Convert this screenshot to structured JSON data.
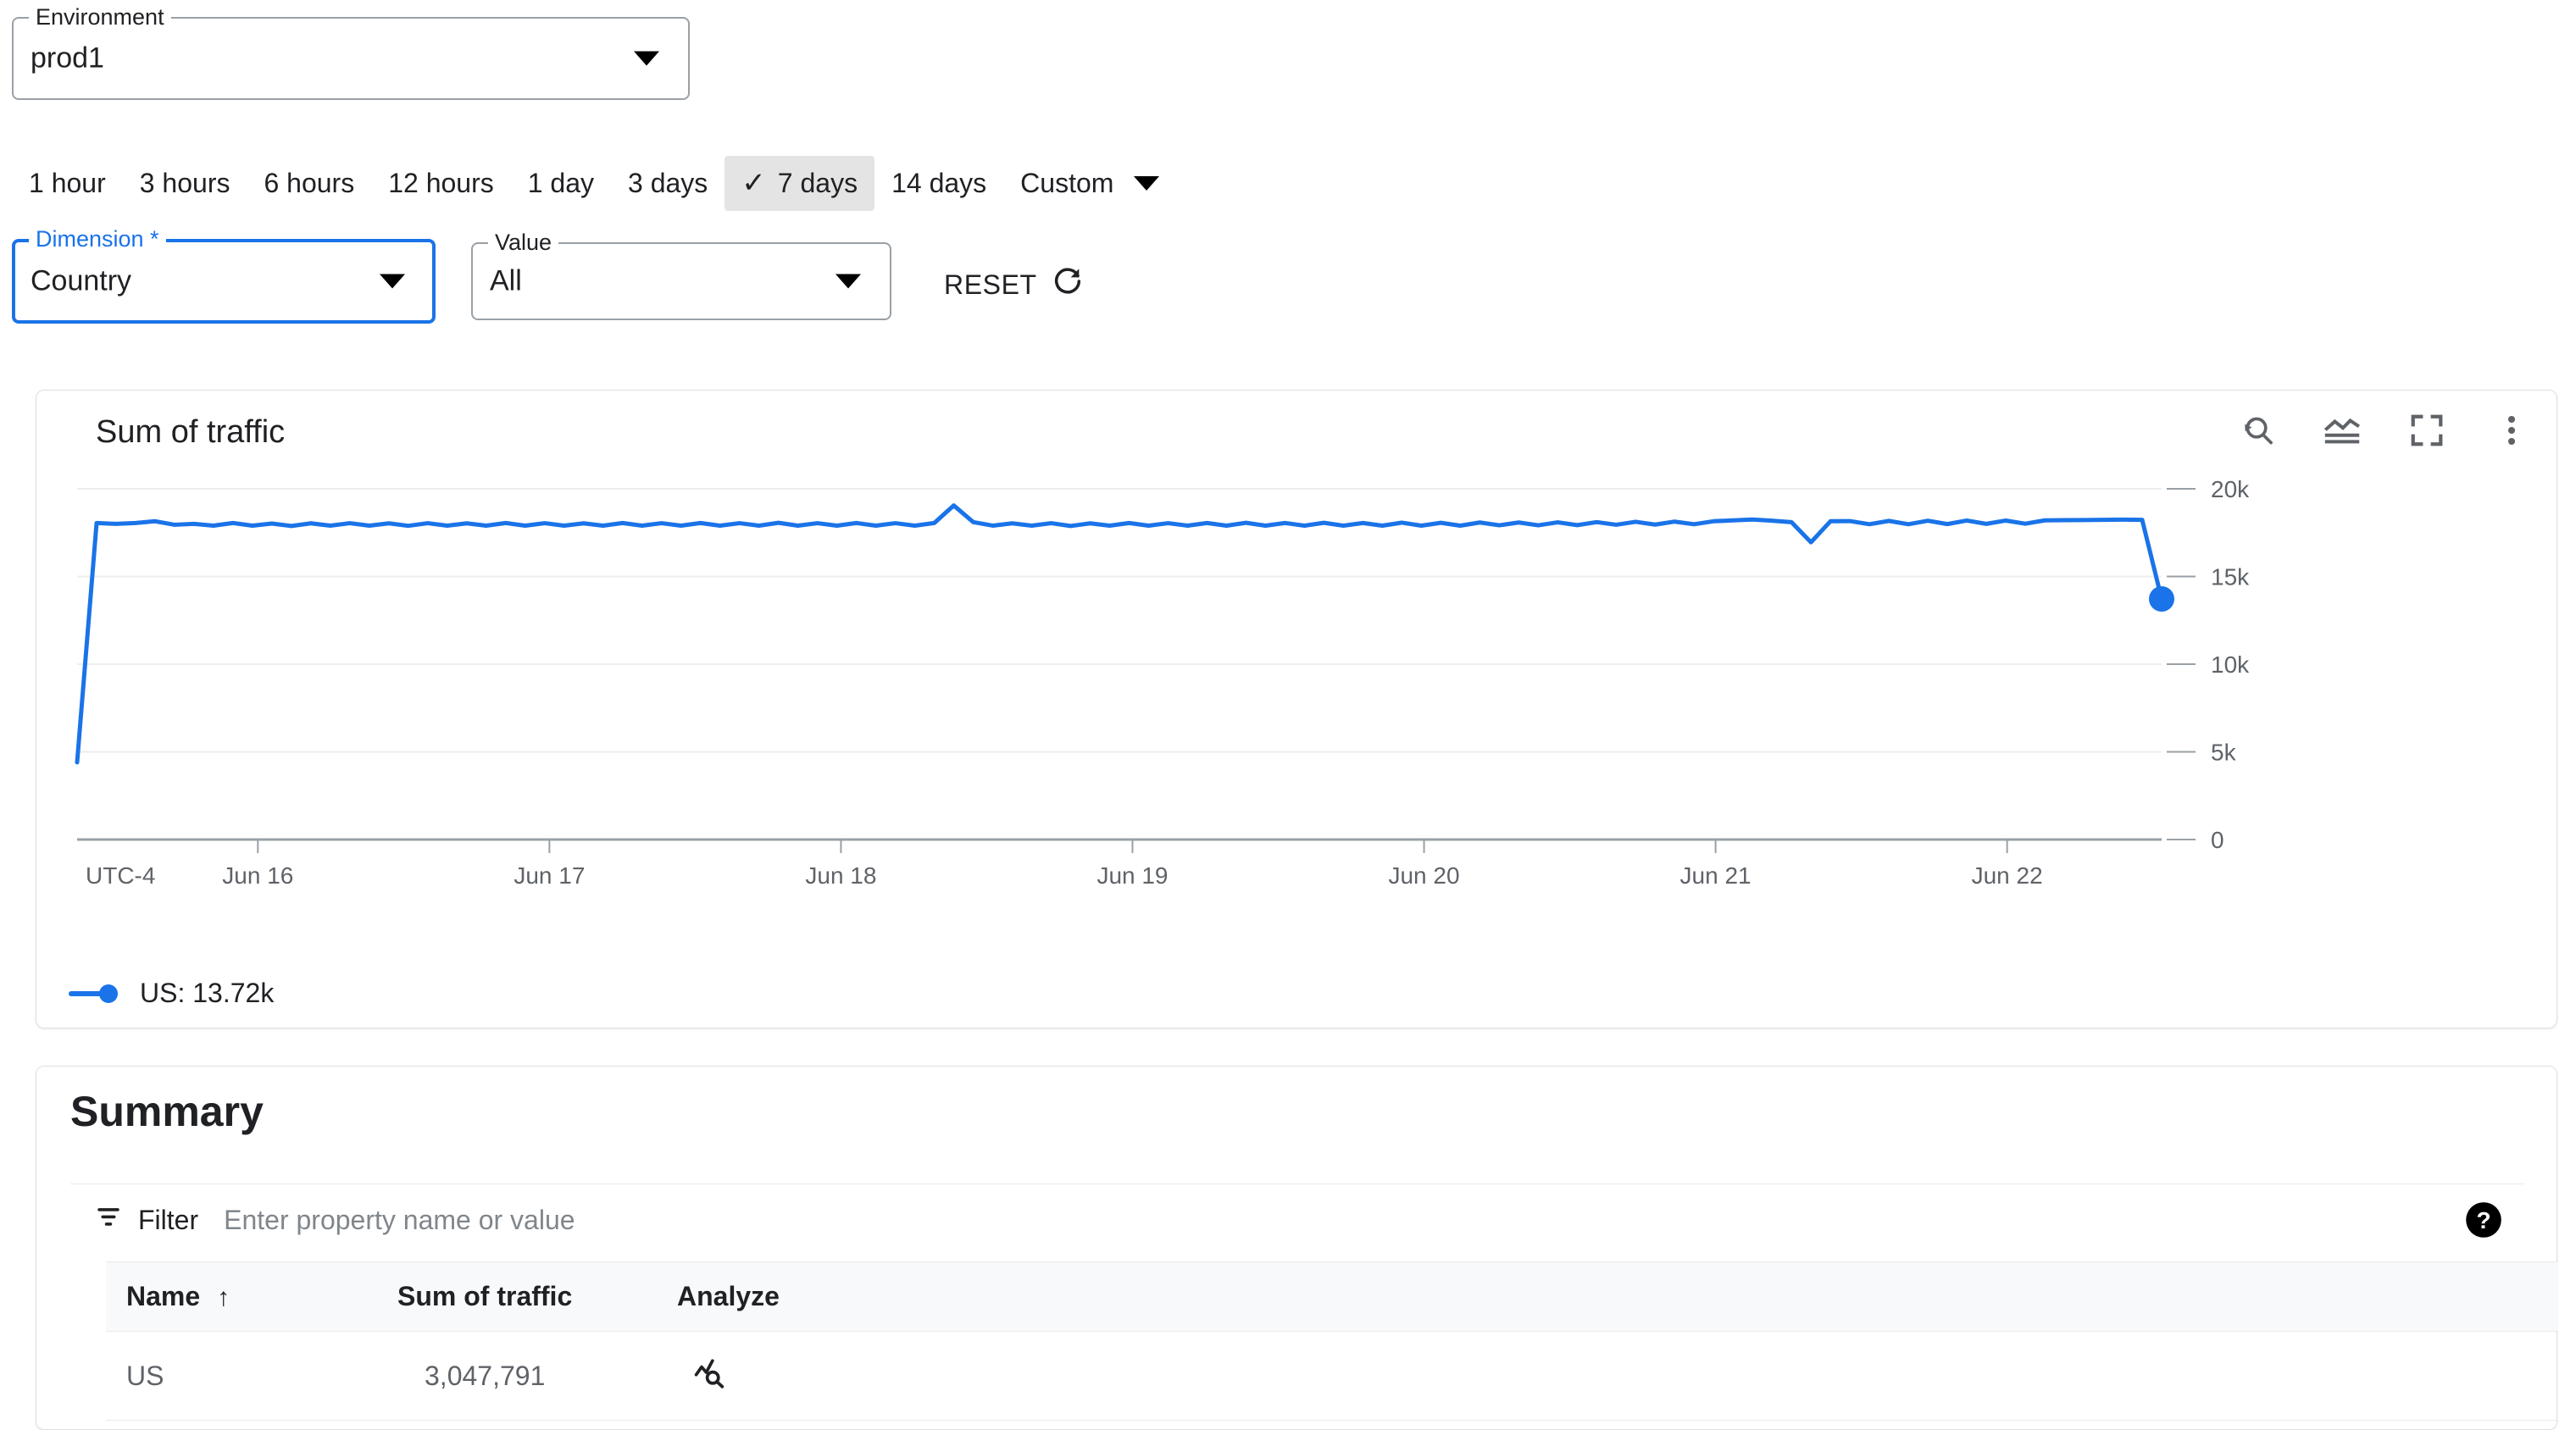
{
  "environment": {
    "label": "Environment",
    "value": "prod1",
    "arrow_icon": "chevron-down-icon"
  },
  "time_ranges": {
    "items": [
      {
        "label": "1 hour",
        "selected": false
      },
      {
        "label": "3 hours",
        "selected": false
      },
      {
        "label": "6 hours",
        "selected": false
      },
      {
        "label": "12 hours",
        "selected": false
      },
      {
        "label": "1 day",
        "selected": false
      },
      {
        "label": "3 days",
        "selected": false
      },
      {
        "label": "7 days",
        "selected": true
      },
      {
        "label": "14 days",
        "selected": false
      }
    ],
    "custom_label": "Custom",
    "check_glyph": "✓"
  },
  "filters": {
    "dimension": {
      "label": "Dimension *",
      "value": "Country",
      "focused": true
    },
    "value": {
      "label": "Value",
      "value": "All",
      "focused": false
    },
    "reset": {
      "label": "RESET",
      "icon": "refresh-icon"
    }
  },
  "chart_card": {
    "title": "Sum of traffic",
    "actions": [
      {
        "name": "reset-zoom-icon",
        "tooltip": "Reset zoom"
      },
      {
        "name": "chart-type-icon",
        "tooltip": "Chart type"
      },
      {
        "name": "fullscreen-icon",
        "tooltip": "Fullscreen"
      },
      {
        "name": "more-vert-icon",
        "tooltip": "More options"
      }
    ],
    "legend": [
      {
        "label": "US: 13.72k",
        "color": "#1a73e8"
      }
    ]
  },
  "summary": {
    "title": "Summary",
    "filter": {
      "label": "Filter",
      "placeholder": "Enter property name or value",
      "value": "",
      "icon": "filter-icon"
    },
    "help_icon": "help-icon",
    "columns": [
      {
        "key": "name",
        "label": "Name",
        "sorted": "asc",
        "sort_glyph": "↑"
      },
      {
        "key": "sum",
        "label": "Sum of traffic"
      },
      {
        "key": "analyze",
        "label": "Analyze"
      }
    ],
    "rows": [
      {
        "name": "US",
        "sum": "3,047,791",
        "analyze_icon": "query-stats-icon"
      }
    ]
  },
  "chart_data": {
    "type": "line",
    "title": "Sum of traffic",
    "xlabel": "",
    "ylabel": "",
    "timezone_label": "UTC-4",
    "x_tick_labels": [
      "Jun 16",
      "Jun 17",
      "Jun 18",
      "Jun 19",
      "Jun 20",
      "Jun 21",
      "Jun 22"
    ],
    "y_tick_labels": [
      "0",
      "5k",
      "10k",
      "15k",
      "20k"
    ],
    "ylim": [
      0,
      20000
    ],
    "grid": true,
    "legend_position": "bottom-left",
    "series": [
      {
        "name": "US",
        "color": "#1a73e8",
        "last_value_label": "13.72k",
        "last_value": 13720,
        "values": [
          4400,
          18050,
          18000,
          18050,
          18150,
          17950,
          18000,
          17900,
          18050,
          17900,
          18020,
          17880,
          18030,
          17900,
          18040,
          17900,
          18030,
          17890,
          18040,
          17900,
          18030,
          17900,
          18050,
          17900,
          18040,
          17900,
          18030,
          17900,
          18050,
          17900,
          18040,
          17900,
          18050,
          17900,
          18040,
          17900,
          18060,
          17900,
          18040,
          17900,
          18050,
          17900,
          18040,
          17900,
          18050,
          19050,
          18100,
          17900,
          18030,
          17900,
          18040,
          17880,
          18030,
          17900,
          18050,
          17900,
          18040,
          17900,
          18050,
          17900,
          18060,
          17900,
          18050,
          17900,
          18060,
          17900,
          18050,
          17900,
          18070,
          17900,
          18060,
          17900,
          18080,
          17920,
          18080,
          17920,
          18090,
          17930,
          18100,
          17950,
          18120,
          17960,
          18130,
          17980,
          18150,
          18200,
          18250,
          18180,
          18100,
          16950,
          18150,
          18160,
          17980,
          18170,
          17980,
          18180,
          17990,
          18190,
          18000,
          18190,
          18010,
          18200,
          18210,
          18220,
          18230,
          18240,
          18230,
          13720
        ]
      }
    ]
  }
}
